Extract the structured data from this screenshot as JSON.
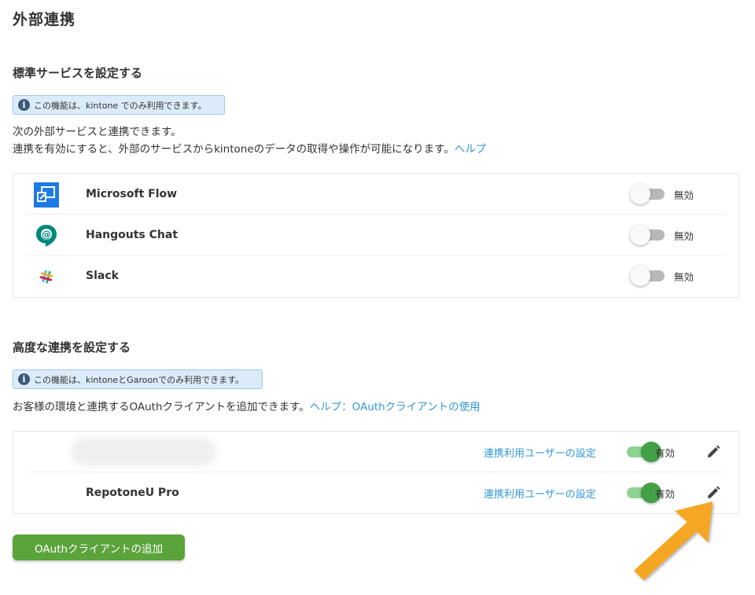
{
  "page": {
    "title": "外部連携"
  },
  "standard": {
    "heading": "標準サービスを設定する",
    "notice": "この機能は、kintone でのみ利用できます。",
    "desc_line1": "次の外部サービスと連携できます。",
    "desc_line2": "連携を有効にすると、外部のサービスからkintoneのデータの取得や操作が可能になります。",
    "help_link": "ヘルプ",
    "services": [
      {
        "name": "Microsoft Flow",
        "icon": "microsoft-flow-icon",
        "status": "無効",
        "enabled": false
      },
      {
        "name": "Hangouts Chat",
        "icon": "hangouts-chat-icon",
        "status": "無効",
        "enabled": false
      },
      {
        "name": "Slack",
        "icon": "slack-icon",
        "status": "無効",
        "enabled": false
      }
    ]
  },
  "advanced": {
    "heading": "高度な連携を設定する",
    "notice": "この機能は、kintoneとGaroonでのみ利用できます。",
    "desc": "お客様の環境と連携するOAuthクライアントを追加できます。",
    "help_link": "ヘルプ：OAuthクライアントの使用",
    "clients": [
      {
        "name": "",
        "user_settings_link": "連携利用ユーザーの設定",
        "status": "有効",
        "enabled": true
      },
      {
        "name": "RepotoneU Pro",
        "user_settings_link": "連携利用ユーザーの設定",
        "status": "有効",
        "enabled": true
      }
    ],
    "add_button": "OAuthクライアントの追加"
  },
  "colors": {
    "link": "#3498db",
    "toggle_on": "#43a047",
    "toggle_off_track": "#b8b8b8",
    "button": "#5ba33b",
    "notice_bg": "#dcebf9",
    "annotation_arrow": "#f5a623"
  }
}
